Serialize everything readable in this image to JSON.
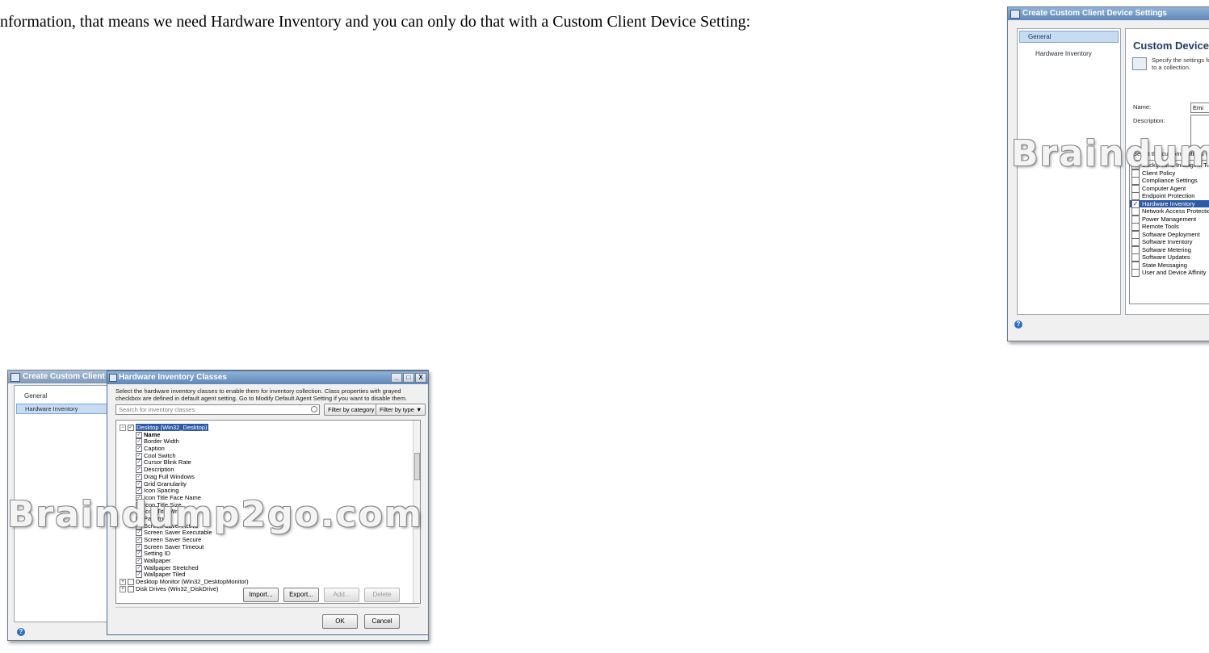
{
  "article": {
    "text": "nformation, that means we need Hardware Inventory and you can only do that with a Custom Client Device Setting:"
  },
  "dialog_settings": {
    "title": "Create Custom Client Device Settings",
    "nav": {
      "general": "General",
      "hardware_inventory": "Hardware Inventory"
    },
    "heading": "Custom Device Se",
    "description_line1": "Specify the settings fo",
    "description_line2": "to a collection.",
    "name_label": "Name:",
    "name_value": "Emi",
    "description_label": "Description:",
    "select_label": "Select the custom settings to",
    "settings": [
      {
        "label": "Background Intelligent Tr",
        "checked": false,
        "selected": false
      },
      {
        "label": "Client Policy",
        "checked": false,
        "selected": false
      },
      {
        "label": "Compliance Settings",
        "checked": false,
        "selected": false
      },
      {
        "label": "Computer Agent",
        "checked": false,
        "selected": false
      },
      {
        "label": "Endpoint Protection",
        "checked": false,
        "selected": false
      },
      {
        "label": "Hardware Inventory",
        "checked": true,
        "selected": true
      },
      {
        "label": "Network Access Protectio",
        "checked": false,
        "selected": false
      },
      {
        "label": "Power Management",
        "checked": false,
        "selected": false
      },
      {
        "label": "Remote Tools",
        "checked": false,
        "selected": false
      },
      {
        "label": "Software Deployment",
        "checked": false,
        "selected": false
      },
      {
        "label": "Software Inventory",
        "checked": false,
        "selected": false
      },
      {
        "label": "Software Metering",
        "checked": false,
        "selected": false
      },
      {
        "label": "Software Updates",
        "checked": false,
        "selected": false
      },
      {
        "label": "State Messaging",
        "checked": false,
        "selected": false
      },
      {
        "label": "User and Device Affinity",
        "checked": false,
        "selected": false
      }
    ]
  },
  "dialog_hw": {
    "parent_title": "Create Custom Client Device Settin",
    "nav": {
      "general": "General",
      "hardware_inventory": "Hardware Inventory"
    },
    "title": "Hardware Inventory Classes",
    "window_controls": [
      "_",
      "□",
      "X"
    ],
    "instructions": "Select the hardware inventory classes to enable them for inventory collection. Class properties with grayed checkbox are defined in default agent setting. Go to Modify Default Agent Setting if you want to disable them.",
    "search_placeholder": "Search for inventory classes",
    "filter_category": "Filter by category ▼",
    "filter_type": "Filter by type ▼",
    "tree_root": "Desktop (Win32_Desktop)",
    "tree_properties": [
      "Name",
      "Border Width",
      "Caption",
      "Cool Switch",
      "Cursor Blink Rate",
      "Description",
      "Drag Full Windows",
      "Grid Granularity",
      "Icon Spacing",
      "Icon Title Face Name",
      "Icon Title Size",
      "Icon Title Wrap",
      "Pattern",
      "Screen Saver Active",
      "Screen Saver Executable",
      "Screen Saver Secure",
      "Screen Saver Timeout",
      "Setting ID",
      "Wallpaper",
      "Wallpaper Stretched",
      "Wallpaper Tiled"
    ],
    "tree_siblings": [
      "Desktop Monitor (Win32_DesktopMonitor)",
      "Disk Drives (Win32_DiskDrive)"
    ],
    "buttons": {
      "import": "Import...",
      "export": "Export...",
      "add": "Add...",
      "delete": "Delete",
      "ok": "OK",
      "cancel": "Cancel"
    }
  },
  "watermarks": {
    "top": "Braindump",
    "bottom": "Braindump2go.com"
  },
  "colors": {
    "titlebar": "#6f93c3",
    "selection": "#2d59a5",
    "nav_selected": "#c7dcf2"
  }
}
